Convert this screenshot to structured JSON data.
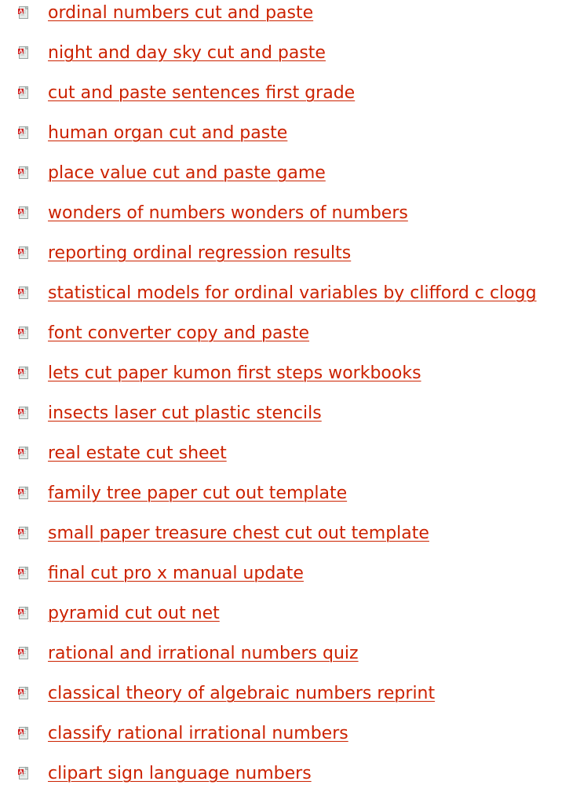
{
  "icon": {
    "name": "pdf-file-icon",
    "accent_color": "#d42020",
    "page_color": "#e6ebe9"
  },
  "link_color": "#cc2200",
  "links": [
    "ordinal numbers cut and paste",
    "night and day sky cut and paste",
    "cut and paste sentences first grade",
    "human organ cut and paste",
    "place value cut and paste game",
    "wonders of numbers wonders of numbers",
    "reporting ordinal regression results",
    "statistical models for ordinal variables by clifford c clogg",
    "font converter copy and paste",
    "lets cut paper kumon first steps workbooks",
    "insects laser cut plastic stencils",
    "real estate cut sheet",
    "family tree paper cut out template",
    "small paper treasure chest cut out template",
    "final cut pro x manual update",
    "pyramid cut out net",
    "rational and irrational numbers quiz",
    "classical theory of algebraic numbers reprint",
    "classify rational irrational numbers",
    "clipart sign language numbers"
  ]
}
